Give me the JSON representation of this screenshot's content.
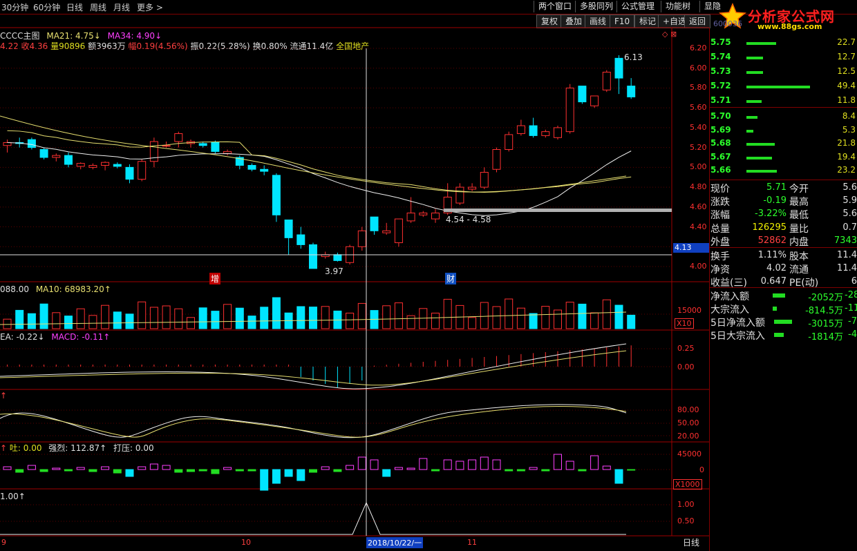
{
  "top_tabs": [
    "30分钟",
    "60分钟",
    "日线",
    "周线",
    "月线",
    "更多 >"
  ],
  "top_menu": [
    "两个窗口",
    "多股同列",
    "公式管理",
    "功能树",
    "显隐"
  ],
  "toolbar": [
    "复权",
    "叠加",
    "画线",
    "F10",
    "标记",
    "+自选",
    "返回"
  ],
  "logo": {
    "title": "分析家公式网",
    "url": "www.88gs.com",
    "faded": "600036"
  },
  "main_title": {
    "name": "CCCC主图",
    "ma21": "MA21: 4.75↓",
    "ma34": "MA34: 4.90↓"
  },
  "info_line": {
    "open_close": "4.22 收4.36",
    "vol": "量90896",
    "amt": "额3963万",
    "chg": "幅0.19(4.56%)",
    "amp": "振0.22(5.28%)",
    "turn": "换0.80%",
    "float": "流通11.4亿",
    "sector": "全国地产"
  },
  "annotations": {
    "high": "6.13",
    "low": "3.97",
    "range": "4.54 - 4.58",
    "tag1": "增",
    "tag2": "财",
    "crosshair_price": "4.13",
    "date": "2018/10/22/一"
  },
  "price_axis": [
    "6.20",
    "6.00",
    "5.80",
    "5.60",
    "5.40",
    "5.20",
    "5.00",
    "4.80",
    "4.60",
    "4.40",
    "4.20",
    "4.00"
  ],
  "vol_panel": {
    "label": "088.00",
    "ma10": "MA10: 68983.20↑",
    "axis": "15000",
    "unit": "X10"
  },
  "macd_panel": {
    "dea": "EA: -0.22↓",
    "macd": "MACD: -0.11↑",
    "axis": [
      "0.25",
      "0.00"
    ]
  },
  "kdj_panel": {
    "axis": [
      "80.00",
      "50.00",
      "20.00"
    ]
  },
  "flow_panel": {
    "tu": "吐: 0.00",
    "qiang": "强烈: 112.87↑",
    "daya": "打压: 0.00",
    "axis": [
      "45000",
      "0"
    ],
    "unit": "X1000"
  },
  "sig_panel": {
    "label": "1.00↑",
    "axis": [
      "1.00",
      "0.50"
    ]
  },
  "date_axis": [
    "9",
    "10",
    "11"
  ],
  "period_label": "日线",
  "order_book": {
    "sell": [
      {
        "p": "5.75",
        "v": "22.7"
      },
      {
        "p": "5.74",
        "v": "12.7"
      },
      {
        "p": "5.73",
        "v": "12.5"
      },
      {
        "p": "5.72",
        "v": "49.4"
      },
      {
        "p": "5.71",
        "v": "11.8"
      }
    ],
    "buy": [
      {
        "p": "5.70",
        "v": "8.4"
      },
      {
        "p": "5.69",
        "v": "5.3"
      },
      {
        "p": "5.68",
        "v": "21.8"
      },
      {
        "p": "5.67",
        "v": "19.4"
      },
      {
        "p": "5.66",
        "v": "23.2"
      }
    ]
  },
  "stats": [
    {
      "k": "现价",
      "v": "5.71",
      "k2": "今开",
      "v2": "5.6"
    },
    {
      "k": "涨跌",
      "v": "-0.19",
      "k2": "最高",
      "v2": "5.9"
    },
    {
      "k": "涨幅",
      "v": "-3.22%",
      "k2": "最低",
      "v2": "5.6"
    },
    {
      "k": "总量",
      "v": "126295",
      "k2": "量比",
      "v2": "0.7"
    },
    {
      "k": "外盘",
      "v": "52862",
      "k2": "内盘",
      "v2": "7343"
    },
    {
      "k": "换手",
      "v": "1.11%",
      "k2": "股本",
      "v2": "11.4"
    },
    {
      "k": "净资",
      "v": "4.02",
      "k2": "流通",
      "v2": "11.4"
    },
    {
      "k": "收益(三)",
      "v": "0.647",
      "k2": "PE(动)",
      "v2": "6"
    }
  ],
  "flows": [
    {
      "k": "净流入额",
      "v": "-2052万",
      "v2": "-28"
    },
    {
      "k": "大宗流入",
      "v": "-814.5万",
      "v2": "-11"
    },
    {
      "k": "5日净流入额",
      "v": "-3015万",
      "v2": "-7"
    },
    {
      "k": "5日大宗流入",
      "v": "-1814万",
      "v2": "-4"
    }
  ],
  "colors": {
    "up": "#ff3030",
    "down": "#00e5ff",
    "ma_yellow": "#e8e070",
    "ma_white": "#f0f0f0",
    "grid": "#800000"
  },
  "chart_data": {
    "type": "candlestick",
    "ylim": [
      3.9,
      6.25
    ],
    "candles": [
      [
        5.22,
        5.28,
        5.15,
        5.25
      ],
      [
        5.25,
        5.3,
        5.2,
        5.24
      ],
      [
        5.28,
        5.3,
        5.18,
        5.2
      ],
      [
        5.18,
        5.2,
        5.08,
        5.1
      ],
      [
        5.1,
        5.14,
        5.06,
        5.12
      ],
      [
        5.12,
        5.15,
        5.0,
        5.03
      ],
      [
        5.01,
        5.05,
        4.98,
        5.04
      ],
      [
        5.0,
        5.04,
        4.98,
        5.02
      ],
      [
        5.02,
        5.06,
        4.97,
        5.05
      ],
      [
        5.03,
        5.05,
        4.99,
        5.01
      ],
      [
        5.0,
        5.03,
        4.84,
        4.88
      ],
      [
        4.88,
        5.08,
        4.86,
        5.06
      ],
      [
        5.06,
        5.3,
        5.0,
        5.26
      ],
      [
        5.22,
        5.26,
        5.2,
        5.22
      ],
      [
        5.26,
        5.36,
        5.2,
        5.34
      ],
      [
        5.24,
        5.28,
        5.2,
        5.26
      ],
      [
        5.24,
        5.26,
        5.2,
        5.22
      ],
      [
        5.25,
        5.27,
        5.14,
        5.16
      ],
      [
        5.14,
        5.18,
        5.12,
        5.16
      ],
      [
        5.1,
        5.12,
        4.98,
        5.02
      ],
      [
        5.02,
        5.04,
        4.96,
        4.98
      ],
      [
        4.98,
        5.02,
        4.92,
        4.96
      ],
      [
        4.92,
        4.94,
        4.45,
        4.52
      ],
      [
        4.47,
        4.47,
        4.12,
        4.29
      ],
      [
        4.32,
        4.4,
        4.18,
        4.22
      ],
      [
        4.22,
        4.24,
        3.98,
        3.98
      ],
      [
        4.1,
        4.15,
        4.08,
        4.12
      ],
      [
        4.12,
        4.14,
        4.05,
        4.06
      ],
      [
        4.04,
        4.22,
        4.02,
        4.2
      ],
      [
        4.2,
        4.4,
        4.16,
        4.36
      ],
      [
        4.5,
        4.5,
        4.32,
        4.36
      ],
      [
        4.34,
        4.44,
        4.32,
        4.36
      ],
      [
        4.24,
        4.48,
        4.2,
        4.48
      ],
      [
        4.46,
        4.7,
        4.44,
        4.54
      ],
      [
        4.52,
        4.56,
        4.5,
        4.54
      ],
      [
        4.48,
        4.58,
        4.44,
        4.54
      ],
      [
        4.54,
        4.84,
        4.52,
        4.7
      ],
      [
        4.64,
        4.84,
        4.62,
        4.8
      ],
      [
        4.78,
        4.84,
        4.76,
        4.8
      ],
      [
        4.8,
        5.0,
        4.78,
        4.95
      ],
      [
        4.98,
        5.2,
        4.95,
        5.18
      ],
      [
        5.18,
        5.36,
        5.16,
        5.33
      ],
      [
        5.34,
        5.48,
        5.32,
        5.42
      ],
      [
        5.42,
        5.5,
        5.3,
        5.32
      ],
      [
        5.32,
        5.38,
        5.3,
        5.36
      ],
      [
        5.3,
        5.42,
        5.28,
        5.4
      ],
      [
        5.36,
        5.84,
        5.34,
        5.8
      ],
      [
        5.82,
        5.82,
        5.64,
        5.66
      ],
      [
        5.62,
        5.72,
        5.6,
        5.72
      ],
      [
        5.78,
        5.98,
        5.76,
        5.96
      ],
      [
        6.1,
        6.13,
        5.74,
        5.9
      ],
      [
        5.82,
        5.9,
        5.69,
        5.71
      ]
    ]
  }
}
